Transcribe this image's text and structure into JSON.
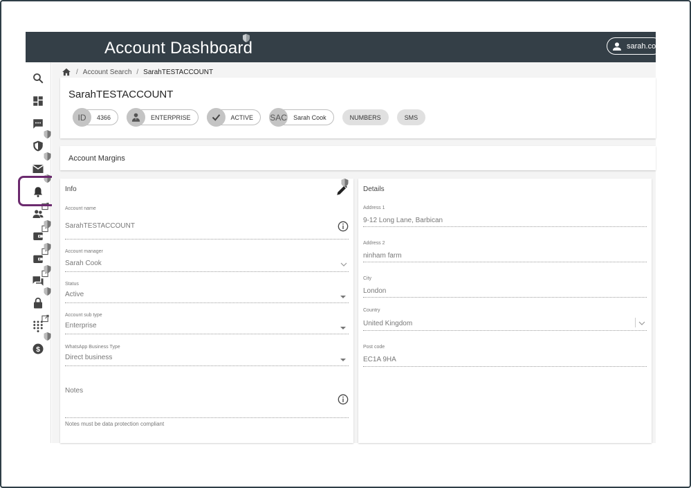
{
  "app": {
    "title": "Account Dashboard",
    "user_label": "sarah.coo"
  },
  "breadcrumb": {
    "items": [
      "Account Search",
      "SarahTESTACCOUNT"
    ]
  },
  "account": {
    "name": "SarahTESTACCOUNT",
    "chips": {
      "id_avatar": "ID",
      "id_value": "4366",
      "type": "ENTERPRISE",
      "status": "ACTIVE",
      "manager_avatar": "SAC",
      "manager": "Sarah Cook",
      "numbers": "NUMBERS",
      "sms": "SMS"
    }
  },
  "margins": {
    "title": "Account Margins"
  },
  "info": {
    "title": "Info",
    "account_name_label": "Account name",
    "account_name_value": "SarahTESTACCOUNT",
    "account_manager_label": "Account manager",
    "account_manager_value": "Sarah Cook",
    "status_label": "Status",
    "status_value": "Active",
    "sub_type_label": "Account sub type",
    "sub_type_value": "Enterprise",
    "whatsapp_label": "WhatsApp Business Type",
    "whatsapp_value": "Direct business",
    "notes_label": "Notes",
    "notes_hint": "Notes must be data protection compliant"
  },
  "details": {
    "title": "Details",
    "address1_label": "Address 1",
    "address1_value": "9-12 Long Lane, Barbican",
    "address2_label": "Address 2",
    "address2_value": "ninham farm",
    "city_label": "City",
    "city_value": "London",
    "country_label": "Country",
    "country_value": "United Kingdom",
    "postcode_label": "Post code",
    "postcode_value": "EC1A 9HA"
  },
  "sidebar": {
    "icons": [
      "search-icon",
      "dashboard-icon",
      "chat-icon",
      "shield-icon",
      "mail-icon",
      "bell-icon",
      "people-icon",
      "wallet-icon",
      "wallet-icon",
      "forum-icon",
      "lock-icon",
      "dialpad-icon",
      "dollar-icon"
    ]
  },
  "colors": {
    "appbar": "#343f47",
    "highlight": "#6b2a6e",
    "icon": "#444444"
  }
}
